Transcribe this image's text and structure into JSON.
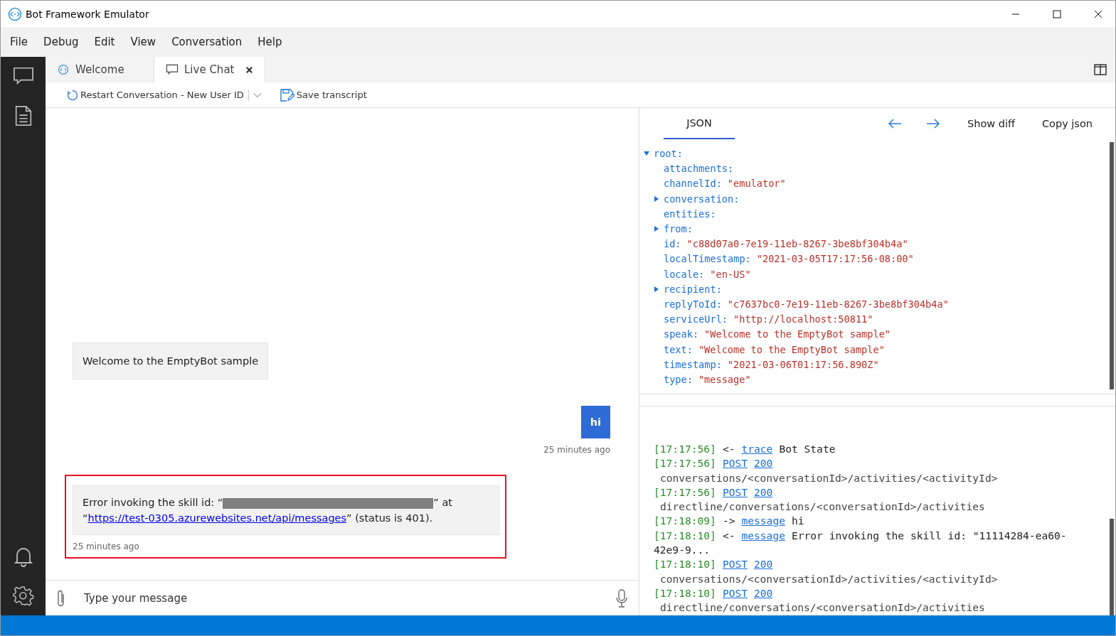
{
  "window": {
    "title": "Bot Framework Emulator"
  },
  "menu": [
    "File",
    "Debug",
    "Edit",
    "View",
    "Conversation",
    "Help"
  ],
  "tabs": [
    {
      "label": "Welcome",
      "selected": false
    },
    {
      "label": "Live Chat",
      "selected": true
    }
  ],
  "toolbar": {
    "restart": "Restart Conversation - New User ID",
    "save": "Save transcript"
  },
  "messages": [
    {
      "kind": "bot",
      "text": "Welcome to the EmptyBot sample",
      "highlighted": false
    },
    {
      "kind": "user",
      "text": "hi",
      "time": "25 minutes ago",
      "highlighted": false
    },
    {
      "kind": "error",
      "before": "Error invoking the skill id: “",
      "after_redaction": "” at “",
      "link": "https://test-0305.azurewebsites.net/api/messages",
      "after": "” (status is 401).",
      "time": "25 minutes ago",
      "highlighted": true
    }
  ],
  "input": {
    "placeholder": "Type your message"
  },
  "inspector": {
    "tabs": [
      {
        "label": "JSON",
        "selected": true
      }
    ],
    "actions": [
      "Show diff",
      "Copy json"
    ],
    "root": {
      "key": "root:",
      "expanded": true,
      "children": [
        {
          "key": "attachments:"
        },
        {
          "key": "channelId:",
          "value": "\"emulator\""
        },
        {
          "key": "conversation:",
          "expanded": false
        },
        {
          "key": "entities:"
        },
        {
          "key": "from:",
          "expanded": false
        },
        {
          "key": "id:",
          "value": "\"c88d07a0-7e19-11eb-8267-3be8bf304b4a\""
        },
        {
          "key": "localTimestamp:",
          "value": "\"2021-03-05T17:17:56-08:00\""
        },
        {
          "key": "locale:",
          "value": "\"en-US\""
        },
        {
          "key": "recipient:",
          "expanded": false
        },
        {
          "key": "replyToId:",
          "value": "\"c7637bc0-7e19-11eb-8267-3be8bf304b4a\""
        },
        {
          "key": "serviceUrl:",
          "value": "\"http://localhost:50811\""
        },
        {
          "key": "speak:",
          "value": "\"Welcome to the EmptyBot sample\""
        },
        {
          "key": "text:",
          "value": "\"Welcome to the EmptyBot sample\""
        },
        {
          "key": "timestamp:",
          "value": "\"2021-03-06T01:17:56.890Z\""
        },
        {
          "key": "type:",
          "value": "\"message\""
        }
      ]
    }
  },
  "log": [
    {
      "time": "[17:17:56]",
      "arrow": "<-",
      "links": [
        "trace"
      ],
      "text": "Bot State"
    },
    {
      "time": "[17:17:56]",
      "links": [
        "POST",
        "200"
      ],
      "path": "conversations/<conversationId>/activities/<activityId>"
    },
    {
      "time": "[17:17:56]",
      "links": [
        "POST",
        "200"
      ],
      "path": "directline/conversations/<conversationId>/activities"
    },
    {
      "time": "[17:18:09]",
      "arrow": "->",
      "links": [
        "message"
      ],
      "text": "hi"
    },
    {
      "time": "[17:18:10]",
      "arrow": "<-",
      "links": [
        "message"
      ],
      "text": "Error invoking the skill id: \"11114284-ea60-",
      "text_wrap": "42e9-9..."
    },
    {
      "time": "[17:18:10]",
      "links": [
        "POST",
        "200"
      ],
      "path": "conversations/<conversationId>/activities/<activityId>"
    },
    {
      "time": "[17:18:10]",
      "links": [
        "POST",
        "200"
      ],
      "path": "directline/conversations/<conversationId>/activities"
    }
  ]
}
